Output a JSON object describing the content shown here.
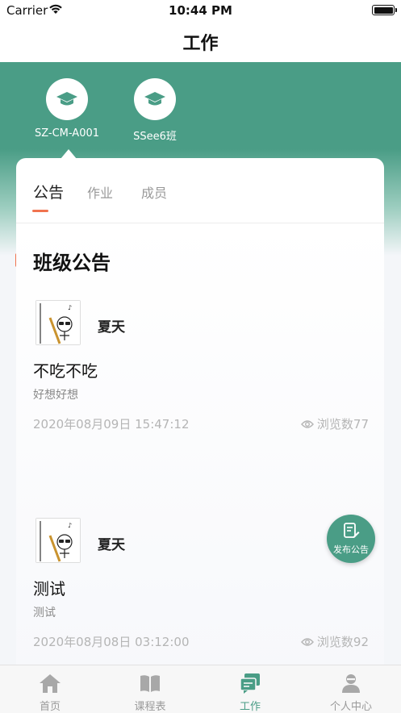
{
  "status_bar": {
    "carrier": "Carrier",
    "time": "10:44 PM"
  },
  "nav": {
    "title": "工作"
  },
  "classes": [
    {
      "name": "SZ-CM-A001",
      "icon": "graduation-cap-icon",
      "selected": true
    },
    {
      "name": "SSee6班",
      "icon": "graduation-cap-icon",
      "selected": false
    }
  ],
  "tabs": [
    {
      "label": "公告",
      "active": true
    },
    {
      "label": "作业",
      "active": false
    },
    {
      "label": "成员",
      "active": false
    }
  ],
  "section": {
    "title": "班级公告"
  },
  "posts": [
    {
      "author": "夏天",
      "title": "不吃不吃",
      "content": "好想好想",
      "time": "2020年08月09日 15:47:12",
      "views": "浏览数77"
    },
    {
      "author": "夏天",
      "title": "测试",
      "content": "测试",
      "time": "2020年08月08日 03:12:00",
      "views": "浏览数92"
    }
  ],
  "fab": {
    "label": "发布公告",
    "icon": "edit-note-icon"
  },
  "tabbar": [
    {
      "label": "首页",
      "icon": "home-icon",
      "active": false
    },
    {
      "label": "课程表",
      "icon": "book-icon",
      "active": false
    },
    {
      "label": "工作",
      "icon": "work-chat-icon",
      "active": true
    },
    {
      "label": "个人中心",
      "icon": "user-icon",
      "active": false
    }
  ],
  "colors": {
    "primary": "#4a9d86",
    "accent": "#f0734f"
  }
}
